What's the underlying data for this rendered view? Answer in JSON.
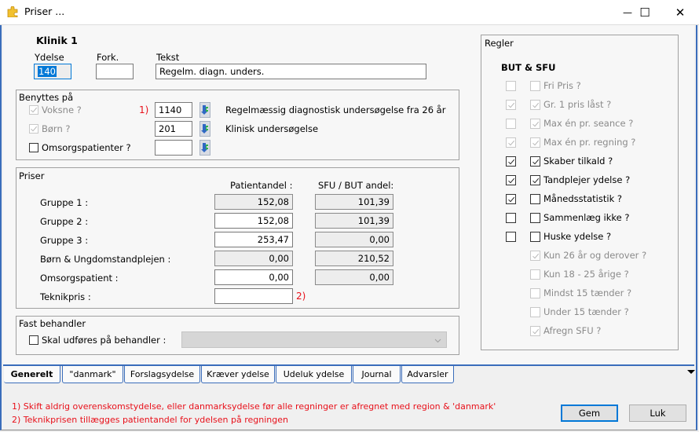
{
  "window": {
    "title": "Priser ...",
    "minimize_glyph": "—",
    "maximize_glyph": "☐",
    "close_glyph": "✕"
  },
  "header": {
    "clinic": "Klinik 1",
    "ydelse_label": "Ydelse",
    "ydelse_value": "140",
    "fork_label": "Fork.",
    "fork_value": "",
    "tekst_label": "Tekst",
    "tekst_value": "Regelm. diagn. unders."
  },
  "benyttes": {
    "title": "Benyttes på",
    "note_marker": "1)",
    "rows": [
      {
        "label": "Voksne ?",
        "checked": true,
        "disabled": true,
        "code": "1140",
        "description": "Regelmæssig diagnostisk undersøgelse fra 26 år"
      },
      {
        "label": "Børn ?",
        "checked": true,
        "disabled": true,
        "code": "201",
        "description": "Klinisk undersøgelse"
      },
      {
        "label": "Omsorgspatienter ?",
        "checked": false,
        "disabled": false,
        "code": "",
        "description": ""
      }
    ]
  },
  "priser": {
    "title": "Priser",
    "col_patient": "Patientandel :",
    "col_sfu": "SFU / BUT andel:",
    "teknik_marker": "2)",
    "rows": [
      {
        "label": "Gruppe 1 :",
        "patient": "152,08",
        "patient_readonly": true,
        "sfu": "101,39"
      },
      {
        "label": "Gruppe 2 :",
        "patient": "152,08",
        "patient_readonly": false,
        "sfu": "101,39"
      },
      {
        "label": "Gruppe 3 :",
        "patient": "253,47",
        "patient_readonly": false,
        "sfu": "0,00"
      },
      {
        "label": "Børn & Ungdomstandplejen :",
        "patient": "0,00",
        "patient_readonly": true,
        "sfu": "210,52"
      },
      {
        "label": "Omsorgspatient :",
        "patient": "0,00",
        "patient_readonly": false,
        "sfu": "0,00"
      },
      {
        "label": "Teknikpris :",
        "patient": "",
        "patient_readonly": false,
        "sfu": null
      }
    ]
  },
  "fast_behandler": {
    "title": "Fast behandler",
    "checkbox_label": "Skal udføres på behandler :",
    "checked": false,
    "combo_value": ""
  },
  "regler": {
    "title": "Regler",
    "subtitle": "BUT & SFU",
    "rows": [
      {
        "label": "Fri Pris ?",
        "left": {
          "checked": false,
          "disabled": true
        },
        "right": {
          "checked": false,
          "disabled": true
        }
      },
      {
        "label": "Gr. 1 pris låst ?",
        "left": {
          "checked": true,
          "disabled": true
        },
        "right": {
          "checked": true,
          "disabled": true
        }
      },
      {
        "label": "Max én pr. seance ?",
        "left": {
          "checked": false,
          "disabled": true
        },
        "right": {
          "checked": true,
          "disabled": true
        }
      },
      {
        "label": "Max én pr. regning ?",
        "left": {
          "checked": true,
          "disabled": true
        },
        "right": {
          "checked": true,
          "disabled": true
        }
      },
      {
        "label": "Skaber tilkald ?",
        "left": {
          "checked": true,
          "disabled": false
        },
        "right": {
          "checked": true,
          "disabled": false
        }
      },
      {
        "label": "Tandplejer ydelse ?",
        "left": {
          "checked": true,
          "disabled": false
        },
        "right": {
          "checked": true,
          "disabled": false
        }
      },
      {
        "label": "Månedsstatistik ?",
        "left": {
          "checked": true,
          "disabled": false
        },
        "right": {
          "checked": false,
          "disabled": false
        }
      },
      {
        "label": "Sammenlæg ikke ?",
        "left": {
          "checked": false,
          "disabled": false
        },
        "right": {
          "checked": false,
          "disabled": false
        }
      },
      {
        "label": "Huske ydelse ?",
        "left": {
          "checked": false,
          "disabled": false
        },
        "right": {
          "checked": false,
          "disabled": false
        }
      },
      {
        "label": "Kun 26 år og derover ?",
        "left": null,
        "right": {
          "checked": true,
          "disabled": true
        }
      },
      {
        "label": "Kun 18 - 25 årige ?",
        "left": null,
        "right": {
          "checked": false,
          "disabled": true
        }
      },
      {
        "label": "Mindst 15 tænder ?",
        "left": null,
        "right": {
          "checked": false,
          "disabled": true
        }
      },
      {
        "label": "Under 15 tænder ?",
        "left": null,
        "right": {
          "checked": false,
          "disabled": true
        }
      },
      {
        "label": "Afregn SFU ?",
        "left": null,
        "right": {
          "checked": true,
          "disabled": true
        }
      }
    ]
  },
  "tabs": [
    {
      "label": "Generelt",
      "active": true
    },
    {
      "label": "\"danmark\"",
      "active": false
    },
    {
      "label": "Forslagsydelse",
      "active": false
    },
    {
      "label": "Kræver ydelse",
      "active": false
    },
    {
      "label": "Udeluk ydelse",
      "active": false
    },
    {
      "label": "Journal",
      "active": false
    },
    {
      "label": "Advarsler",
      "active": false
    }
  ],
  "footer": {
    "note1": "1) Skift aldrig overenskomstydelse, eller danmarksydelse før alle regninger er afregnet med region & 'danmark'",
    "note2": "2) Teknikprisen tillægges patientandel for ydelsen på regningen",
    "save_label": "Gem",
    "close_label": "Luk"
  },
  "colors": {
    "accent": "#3a6dbb",
    "note_red": "#e8101a",
    "default_button_border": "#0078d7"
  }
}
